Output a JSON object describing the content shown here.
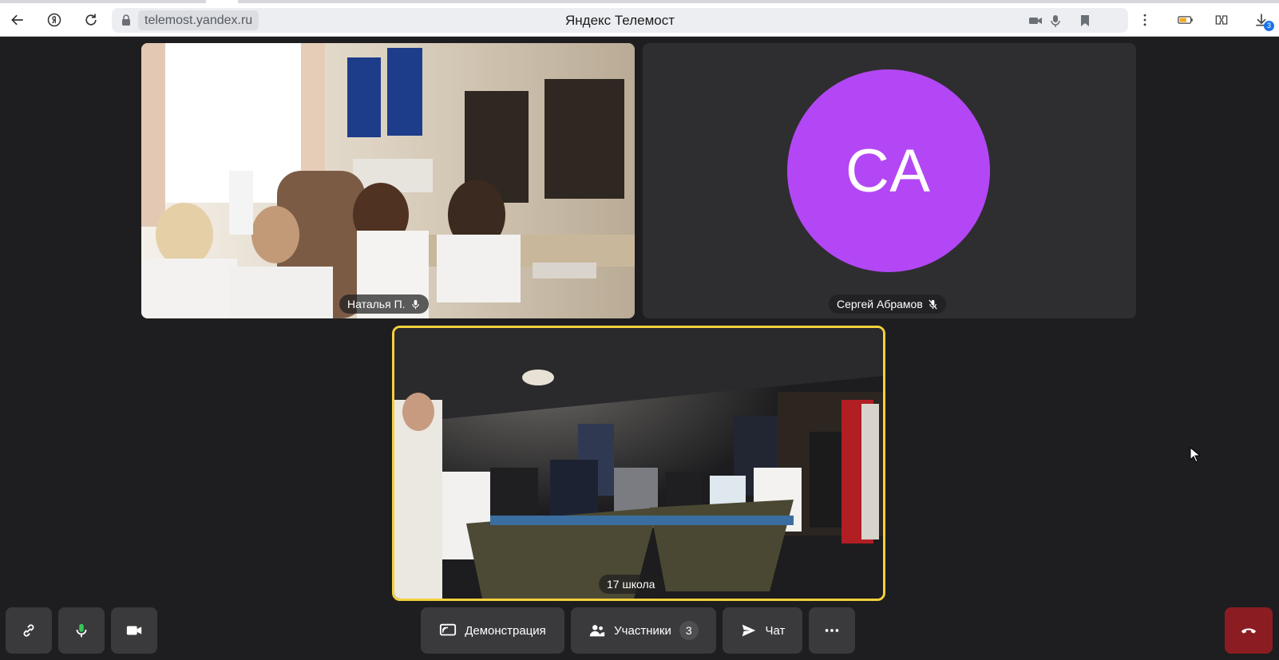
{
  "browser": {
    "url": "telemost.yandex.ru",
    "title": "Яндекс Телемост",
    "downloads_badge": "3",
    "icons": [
      "back-icon",
      "yandex-icon",
      "reload-icon",
      "lock-icon",
      "camera-icon",
      "mic-icon",
      "bookmark-icon",
      "more-vert-icon",
      "battery-icon",
      "extensions-icon",
      "downloads-icon"
    ]
  },
  "participants": [
    {
      "name": "Наталья П.",
      "mic": "on",
      "kind": "video-classroom"
    },
    {
      "name": "Сергей Абрамов",
      "mic": "muted",
      "kind": "avatar",
      "initials": "СА",
      "avatar_color": "#b347f5"
    },
    {
      "name": "17 школа",
      "kind": "video-hall",
      "active_speaker": true
    }
  ],
  "toolbar": {
    "demo_label": "Демонстрация",
    "participants_label": "Участники",
    "participants_count": "3",
    "chat_label": "Чат"
  },
  "colors": {
    "background": "#1e1e20",
    "active_speaker_border": "#f5d13c",
    "end_call": "#8b1d22",
    "avatar": "#b347f5"
  }
}
